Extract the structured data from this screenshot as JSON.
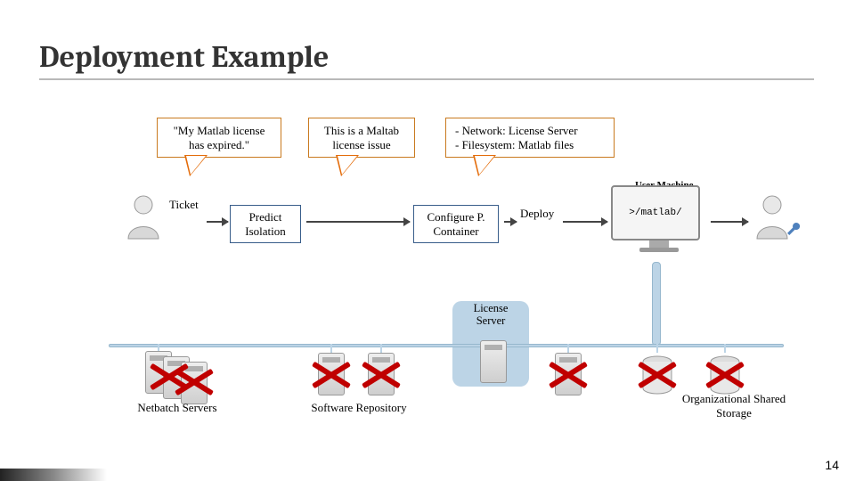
{
  "title": "Deployment Example",
  "slide_number": "14",
  "bubbles": {
    "b1": "\"My Matlab license has expired.\"",
    "b2": "This is a Maltab license issue",
    "b3_line1": "- Network: License Server",
    "b3_line2": "- Filesystem:  Matlab files"
  },
  "labels": {
    "ticket": "Ticket",
    "user_machine": "User Machine",
    "deploy": "Deploy",
    "matlab_prompt": ">/matlab/",
    "license_server": "License Server",
    "netbatch": "Netbatch Servers",
    "software_repo": "Software Repository",
    "org_storage": "Organizational Shared Storage"
  },
  "process": {
    "predict": "Predict Isolation",
    "configure": "Configure P. Container"
  }
}
